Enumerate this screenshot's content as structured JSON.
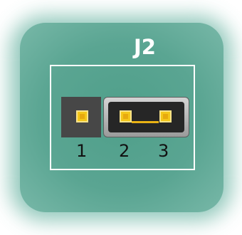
{
  "header": {
    "connector_label": "J2"
  },
  "pins": {
    "pin1_label": "1",
    "pin2_label": "2",
    "pin3_label": "3"
  },
  "jumper": {
    "shorted_pins": [
      "2",
      "3"
    ]
  },
  "colors": {
    "board": "#5aa592",
    "silkscreen": "#ffffff",
    "pad": "#f3c619",
    "jumper_body": "#262626"
  }
}
